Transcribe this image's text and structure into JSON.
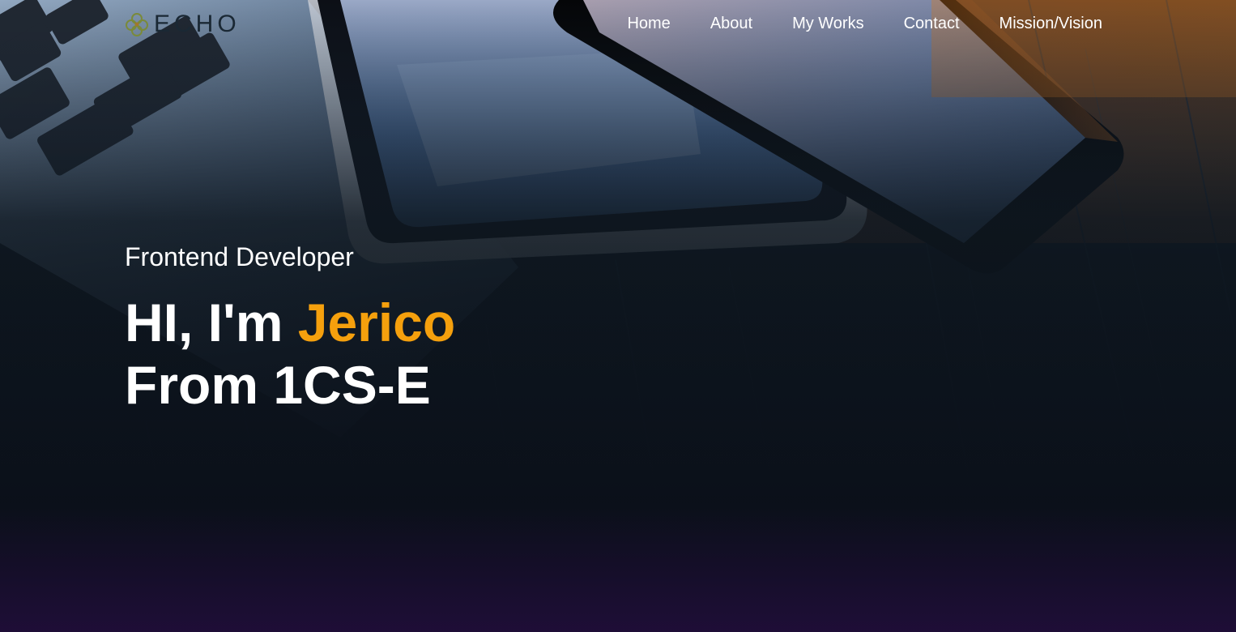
{
  "brand": {
    "logo_text": "ECHO",
    "logo_icon": "flower-logo-icon",
    "accent_color": "#f5a00d"
  },
  "nav": {
    "items": [
      {
        "label": "Home"
      },
      {
        "label": "About"
      },
      {
        "label": "My Works"
      },
      {
        "label": "Contact"
      },
      {
        "label": "Mission/Vision"
      }
    ]
  },
  "hero": {
    "subtitle": "Frontend Developer",
    "greeting": "HI, I'm ",
    "name": "Jerico",
    "line2": "From 1CS-E",
    "background": "laptop-tablet-phone-on-wood-photo"
  }
}
